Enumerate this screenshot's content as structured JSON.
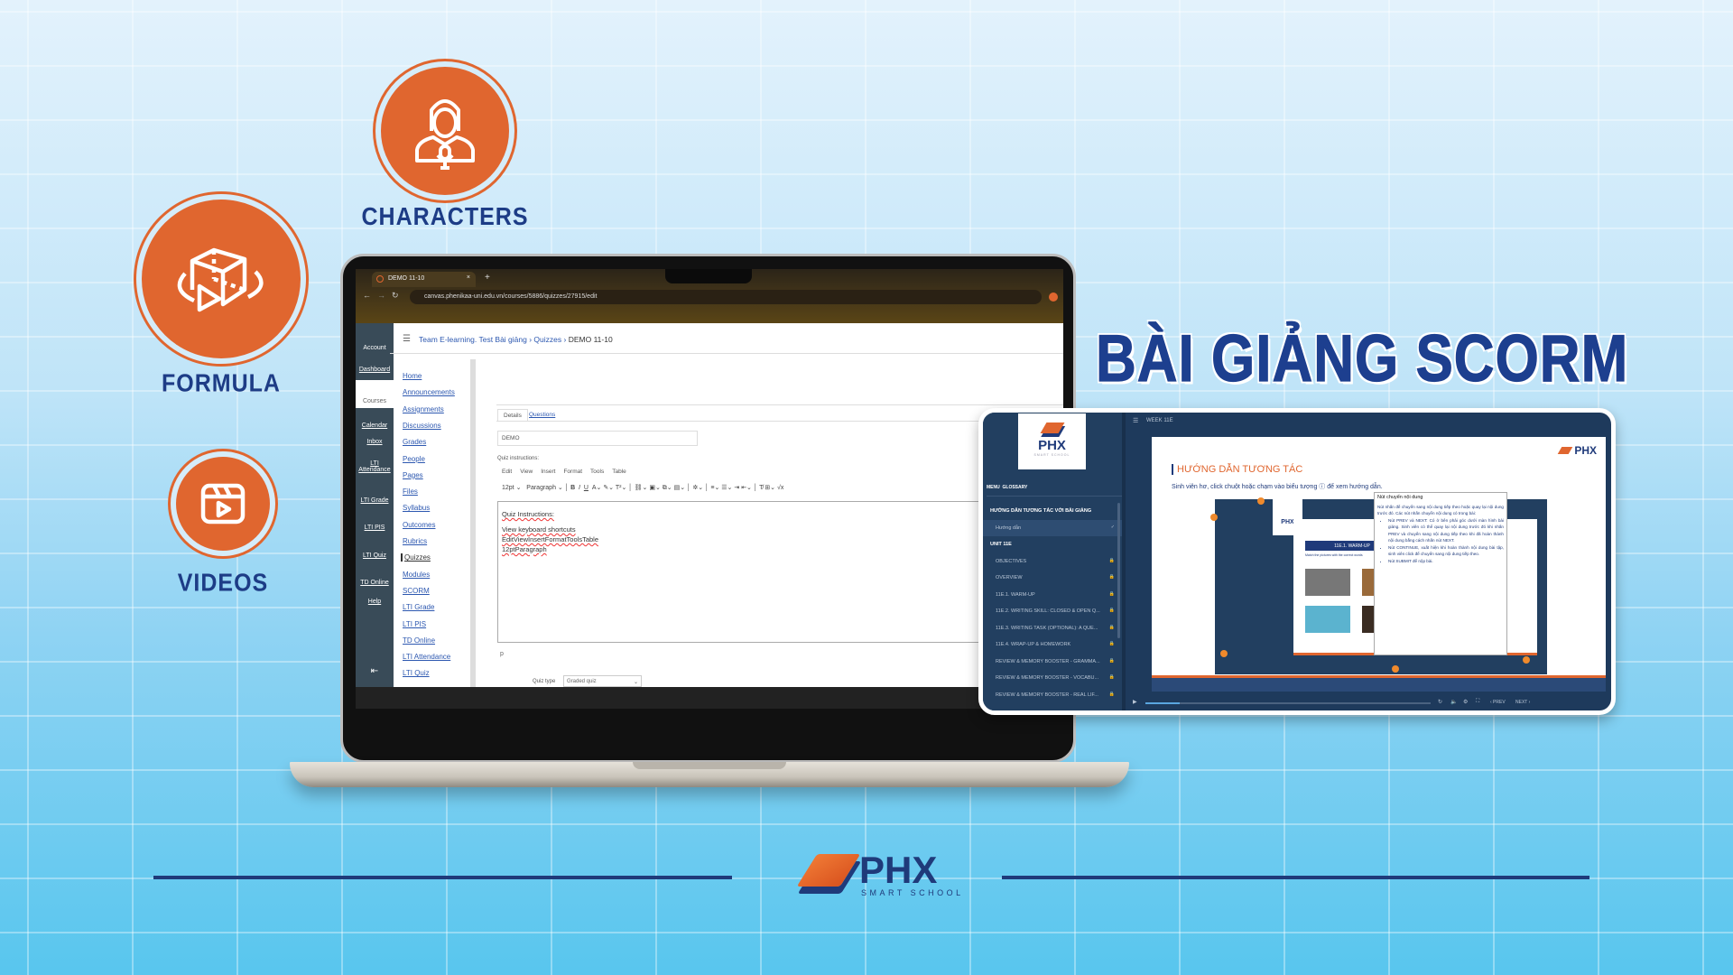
{
  "features": [
    {
      "label": "CHARACTERS",
      "icon": "presenter-mic-icon"
    },
    {
      "label": "FORMULA",
      "icon": "3d-cube-play-icon"
    },
    {
      "label": "VIDEOS",
      "icon": "video-clapper-icon"
    }
  ],
  "headline": "BÀI GIẢNG SCORM",
  "colors": {
    "orange": "#e0662f",
    "navy": "#1d3c86",
    "tablet": "#1e3a5c"
  },
  "browser": {
    "tab_title": "DEMO 11-10",
    "url": "canvas.phenikaa-uni.edu.vn/courses/5886/quizzes/27915/edit"
  },
  "canvas": {
    "breadcrumb": [
      "Team E-learning. Test Bài giảng",
      "Quizzes",
      "DEMO 11-10"
    ],
    "global_nav": [
      "Account",
      "Dashboard",
      "Courses",
      "Calendar",
      "Inbox",
      "LTI Attendance",
      "LTI Grade",
      "LTI PIS",
      "LTI Quiz",
      "TD Online",
      "Help"
    ],
    "course_nav": [
      "Home",
      "Announcements",
      "Assignments",
      "Discussions",
      "Grades",
      "People",
      "Pages",
      "Files",
      "Syllabus",
      "Outcomes",
      "Rubrics",
      "Quizzes",
      "Modules",
      "SCORM",
      "LTI Grade",
      "LTI PIS",
      "TD Online",
      "LTI Attendance",
      "LTI Quiz"
    ],
    "active_course_nav": "Quizzes",
    "tabs": [
      "Details",
      "Questions"
    ],
    "quiz_title": "DEMO",
    "instructions_label": "Quiz instructions:",
    "editor_menu": [
      "Edit",
      "View",
      "Insert",
      "Format",
      "Tools",
      "Table"
    ],
    "font_size": "12pt",
    "block": "Paragraph",
    "editor_lines": [
      "Quiz Instructions:",
      "View keyboard shortcuts",
      "EditViewInsertFormatToolsTable",
      "12ptParagraph"
    ],
    "status_path": "p",
    "quiz_type_label": "Quiz type",
    "quiz_type_value": "Graded quiz"
  },
  "scorm": {
    "week": "WEEK 11E",
    "logo": "PHX",
    "logo_sub": "SMART SCHOOL",
    "menu_tabs": [
      "MENU",
      "GLOSSARY"
    ],
    "items": [
      {
        "label": "HƯỚNG DẪN TƯƠNG TÁC VỚI BÀI GIẢNG",
        "type": "section"
      },
      {
        "label": "Hướng dẫn",
        "type": "active"
      },
      {
        "label": "UNIT 11E",
        "type": "section"
      },
      {
        "label": "OBJECTIVES",
        "type": "locked"
      },
      {
        "label": "OVERVIEW",
        "type": "locked"
      },
      {
        "label": "11E.1. WARM-UP",
        "type": "locked"
      },
      {
        "label": "11E.2. WRITING SKILL: CLOSED & OPEN Q...",
        "type": "locked"
      },
      {
        "label": "11E.3. WRITING TASK (OPTIONAL): A QUE...",
        "type": "locked"
      },
      {
        "label": "11E.4. WRAP-UP & HOMEWORK",
        "type": "locked"
      },
      {
        "label": "REVIEW & MEMORY BOOSTER - GRAMMA...",
        "type": "locked"
      },
      {
        "label": "REVIEW & MEMORY BOOSTER - VOCABU...",
        "type": "locked"
      },
      {
        "label": "REVIEW & MEMORY BOOSTER - REAL LIF...",
        "type": "locked"
      }
    ],
    "slide_title": "HƯỚNG DẪN TƯƠNG TÁC",
    "slide_sub": "Sinh viên hơ, click  chuột hoặc chạm vào biểu tượng ⓘ để xem hướng dẫn.",
    "inner_heading": "11E.1. WARM-UP",
    "inner_sub": "Match the pictures with the correct words",
    "tooltip_title": "Nút chuyển nội dung",
    "tooltip_intro": "Nút nhấn để chuyển sang nội dung tiếp theo hoặc quay lại nội dung trước đó. Các nút nhấn chuyển nội dung có trong bài:",
    "tooltip_bullets": [
      "Nút PREV và NEXT: Có ở bên phải góc dưới màn hình bài giảng. Sinh viên có thể quay lại nội dung trước đó khi nhấn PREV và chuyển sang nội dung tiếp theo khi đã hoàn thành nội dung bằng cách nhấn nút NEXT.",
      "Nút CONTINUE, xuất hiện khi hoàn thành nội dung bài tập, sinh viên click để chuyển sang nội dung tiếp theo.",
      "Nút SUBMIT để nộp bài."
    ],
    "prev": "‹ PREV",
    "next": "NEXT ›",
    "progress": 0.12
  },
  "footer_logo": {
    "text": "PHX",
    "sub": "SMART SCHOOL"
  }
}
